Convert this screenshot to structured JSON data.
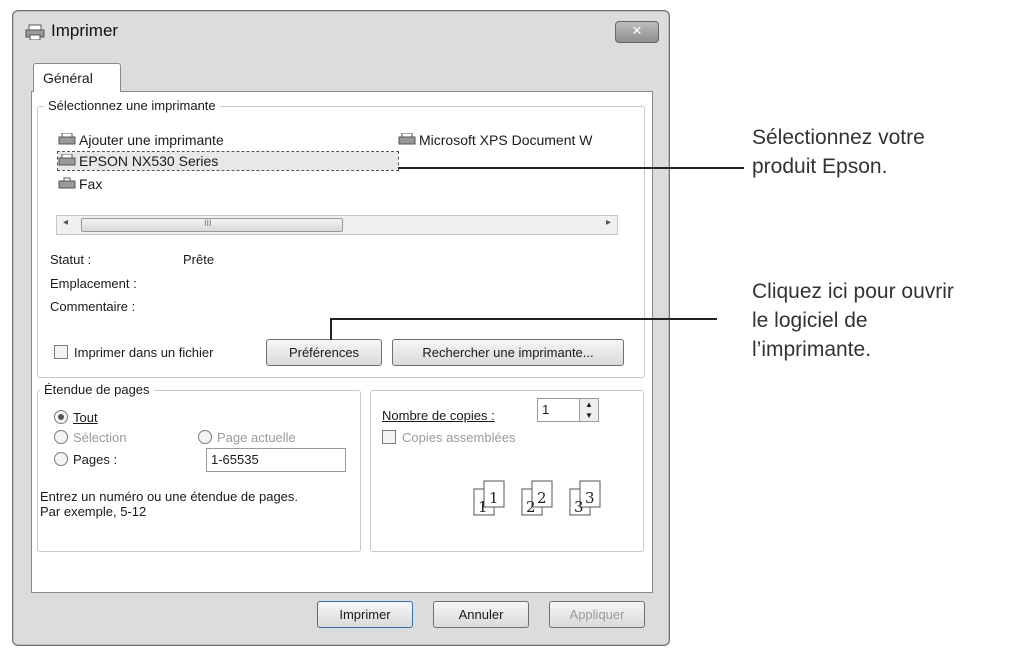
{
  "window": {
    "title": "Imprimer",
    "close": "✕"
  },
  "tab": {
    "label": "Général"
  },
  "printer_group": {
    "label": "Sélectionnez une imprimante",
    "printers": [
      {
        "name": "Ajouter une imprimante",
        "icon": "add-printer-icon"
      },
      {
        "name": "Microsoft XPS Document W",
        "icon": "printer-icon"
      },
      {
        "name": "EPSON NX530 Series",
        "icon": "printer-icon",
        "selected": true
      },
      {
        "name": "Fax",
        "icon": "fax-icon"
      }
    ],
    "scroll_label": "III",
    "scroll_left": "◂",
    "scroll_right": "▸"
  },
  "status": {
    "status_label": "Statut :",
    "status_value": "Prête",
    "location_label": "Emplacement :",
    "comment_label": "Commentaire :"
  },
  "print_to_file": "Imprimer dans un fichier",
  "buttons": {
    "preferences": "Préférences",
    "find_printer": "Rechercher une imprimante...",
    "print": "Imprimer",
    "cancel": "Annuler",
    "apply": "Appliquer"
  },
  "page_range": {
    "label": "Étendue de pages",
    "all": "Tout",
    "selection": "Sélection",
    "current_page": "Page actuelle",
    "pages": "Pages :",
    "pages_value": "1-65535",
    "hint_line1": "Entrez un numéro ou une étendue de pages.",
    "hint_line2": "Par exemple, 5-12"
  },
  "copies": {
    "label": "Nombre de copies :",
    "value": "1",
    "collate": "Copies assemblées",
    "collate_glyphs": [
      "1",
      "1",
      "2",
      "2",
      "3",
      "3"
    ]
  },
  "annotations": {
    "select_line1": "Sélectionnez votre",
    "select_line2": "produit Epson.",
    "click_line1": "Cliquez ici pour ouvrir",
    "click_line2": "le logiciel de",
    "click_line3": "l’imprimante."
  }
}
